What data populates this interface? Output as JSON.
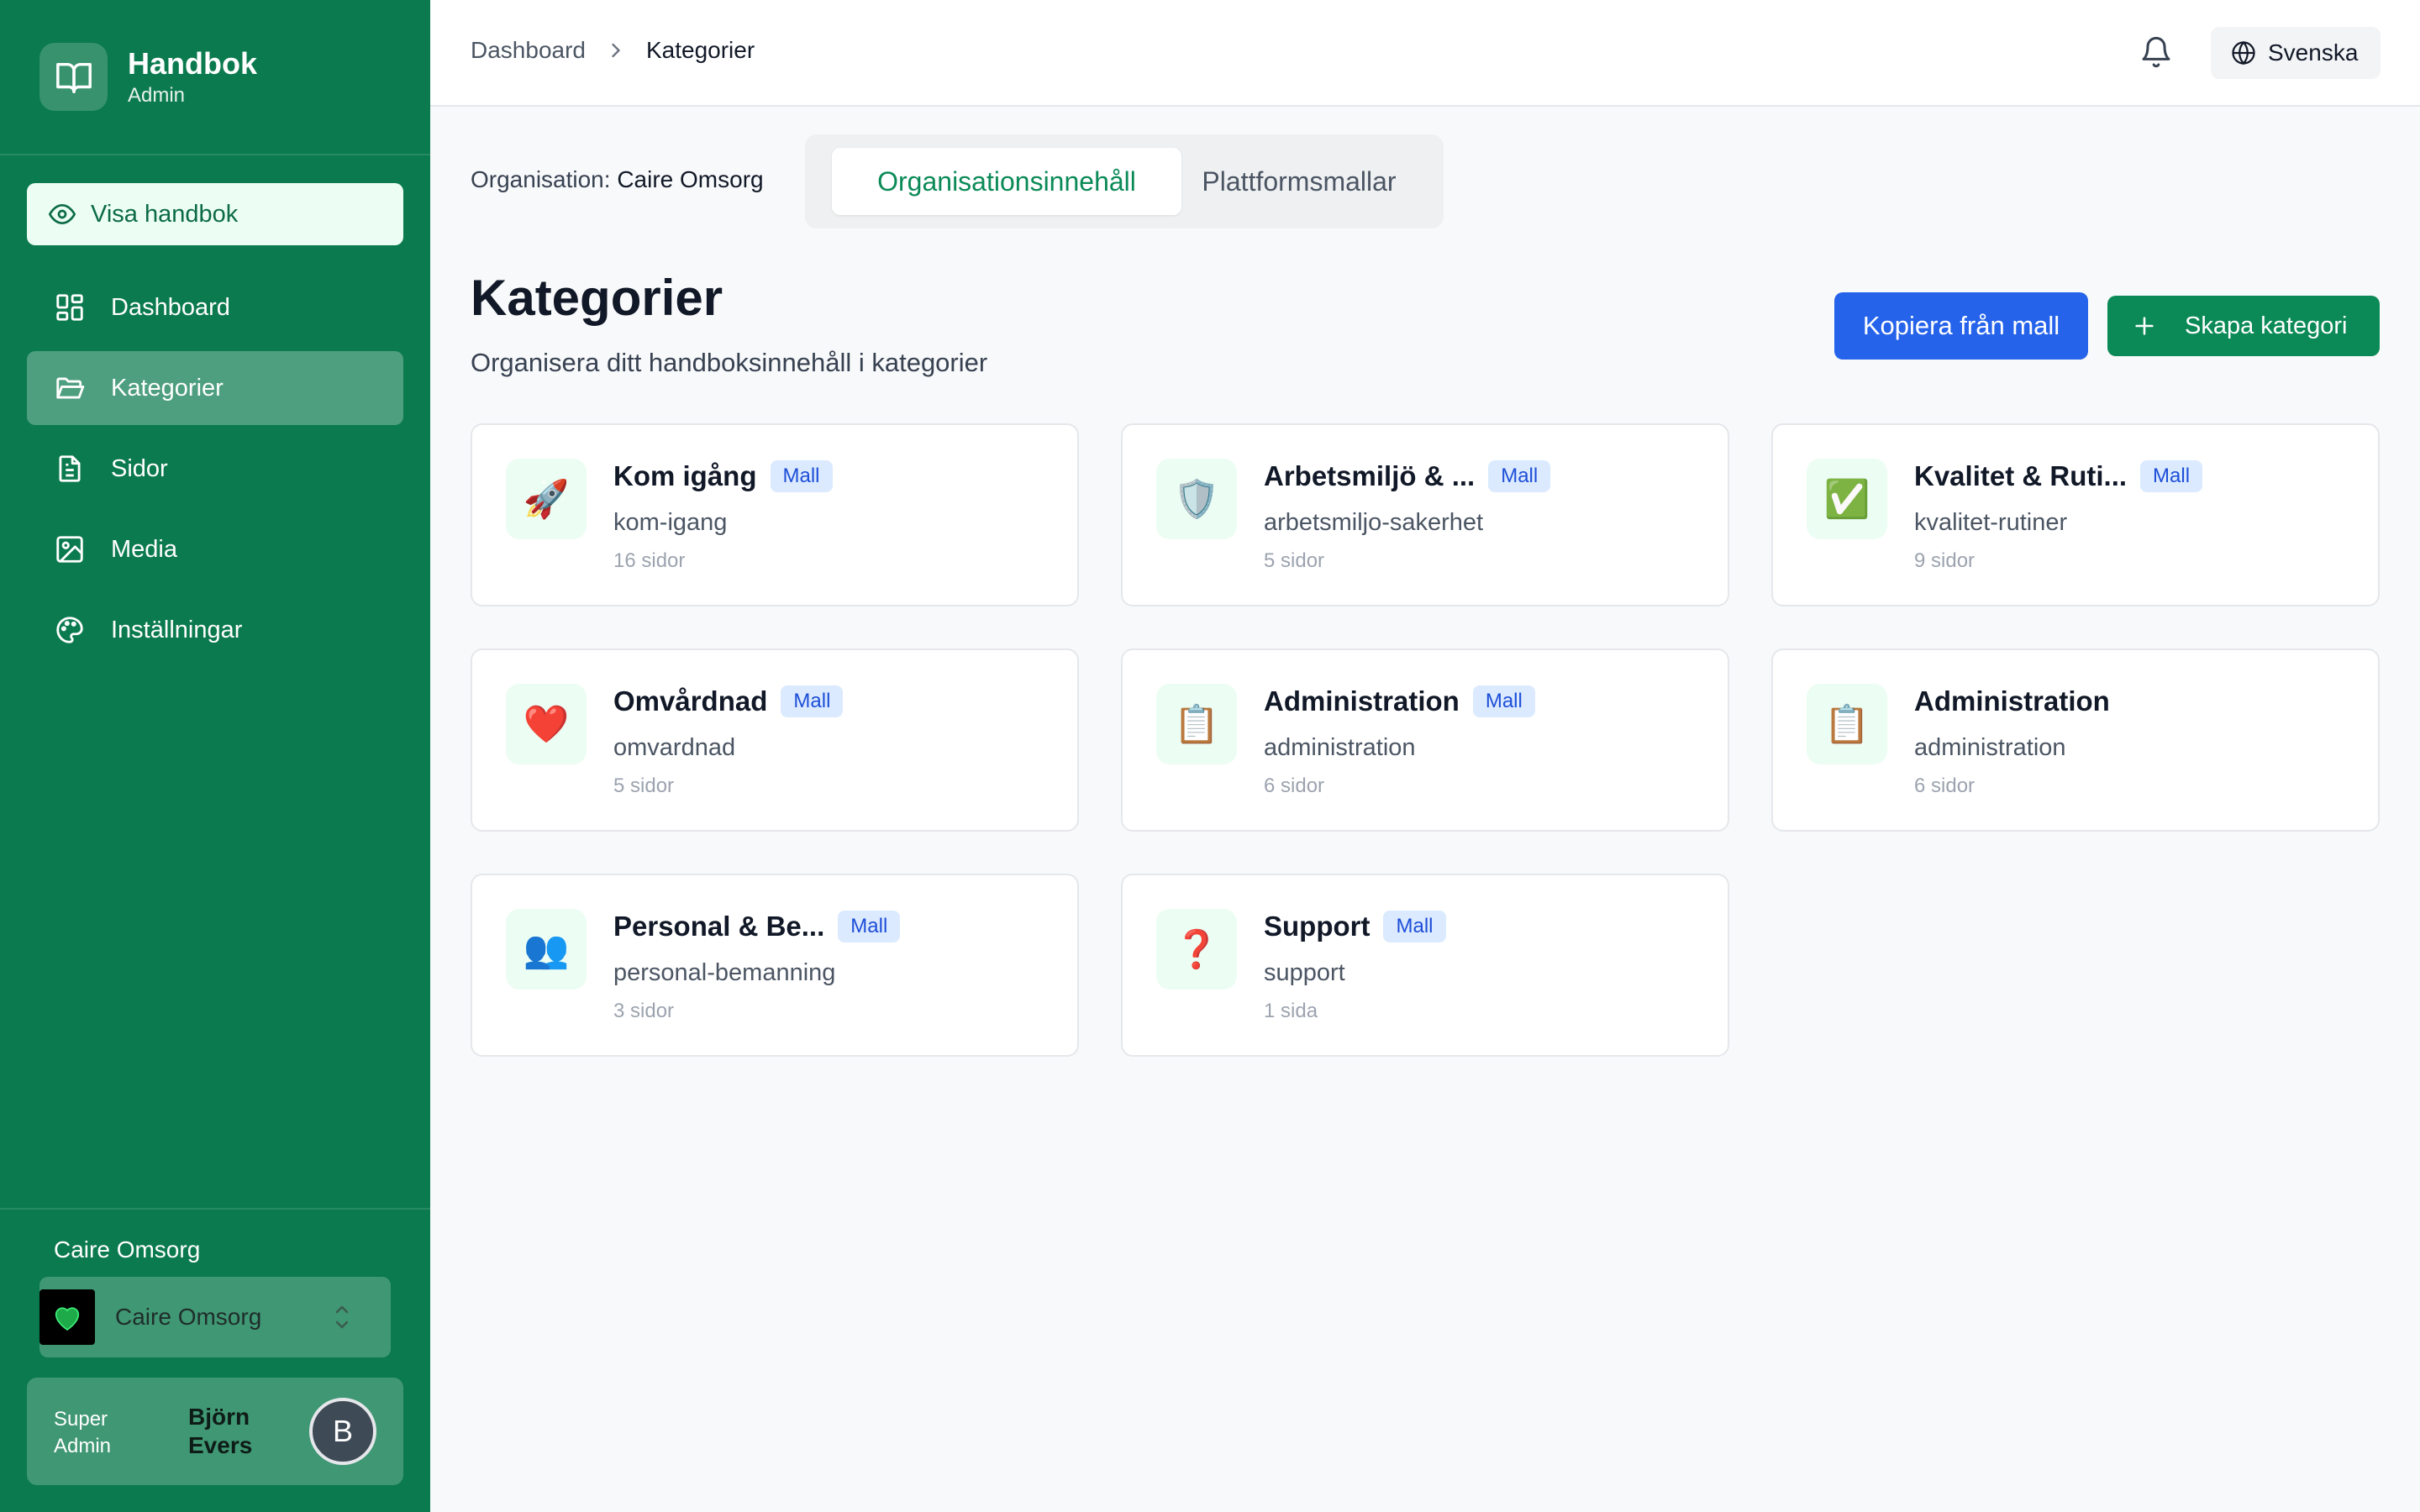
{
  "brand": {
    "title": "Handbok",
    "subtitle": "Admin"
  },
  "sidebar": {
    "view_button": "Visa handbok",
    "items": [
      {
        "label": "Dashboard",
        "icon": "dashboard-icon"
      },
      {
        "label": "Kategorier",
        "icon": "folder-icon",
        "active": true
      },
      {
        "label": "Sidor",
        "icon": "page-icon"
      },
      {
        "label": "Media",
        "icon": "image-icon"
      },
      {
        "label": "Inställningar",
        "icon": "palette-icon"
      }
    ],
    "org_label": "Caire Omsorg",
    "org_select": "Caire Omsorg",
    "user": {
      "role": "Super Admin",
      "name": "Björn Evers",
      "initial": "B"
    }
  },
  "topbar": {
    "breadcrumbs": [
      "Dashboard",
      "Kategorier"
    ],
    "language": "Svenska"
  },
  "org_line": {
    "label": "Organisation:",
    "value": "Caire Omsorg"
  },
  "tabs": [
    {
      "label": "Organisationsinnehåll",
      "active": true
    },
    {
      "label": "Plattformsmallar",
      "active": false
    }
  ],
  "header": {
    "title": "Kategorier",
    "subtitle": "Organisera ditt handboksinnehåll i kategorier",
    "copy_button": "Kopiera från mall",
    "create_button": "Skapa kategori"
  },
  "categories": [
    {
      "emoji": "🚀",
      "title": "Kom igång",
      "badge": "Mall",
      "slug": "kom-igang",
      "count": "16 sidor"
    },
    {
      "emoji": "🛡️",
      "title": "Arbetsmiljö & ...",
      "badge": "Mall",
      "slug": "arbetsmiljo-sakerhet",
      "count": "5 sidor"
    },
    {
      "emoji": "✅",
      "title": "Kvalitet & Ruti...",
      "badge": "Mall",
      "slug": "kvalitet-rutiner",
      "count": "9 sidor"
    },
    {
      "emoji": "❤️",
      "title": "Omvårdnad",
      "badge": "Mall",
      "slug": "omvardnad",
      "count": "5 sidor"
    },
    {
      "emoji": "📋",
      "title": "Administration",
      "badge": "Mall",
      "slug": "administration",
      "count": "6 sidor"
    },
    {
      "emoji": "📋",
      "title": "Administration",
      "badge": "",
      "slug": "administration",
      "count": "6 sidor"
    },
    {
      "emoji": "👥",
      "title": "Personal & Be...",
      "badge": "Mall",
      "slug": "personal-bemanning",
      "count": "3 sidor"
    },
    {
      "emoji": "❓",
      "title": "Support",
      "badge": "Mall",
      "slug": "support",
      "count": "1 sida"
    }
  ],
  "colors": {
    "sidebar": "#0b7a4e",
    "accent_green": "#0b8a57",
    "accent_blue": "#2563eb",
    "badge_bg": "#dbeafe"
  }
}
